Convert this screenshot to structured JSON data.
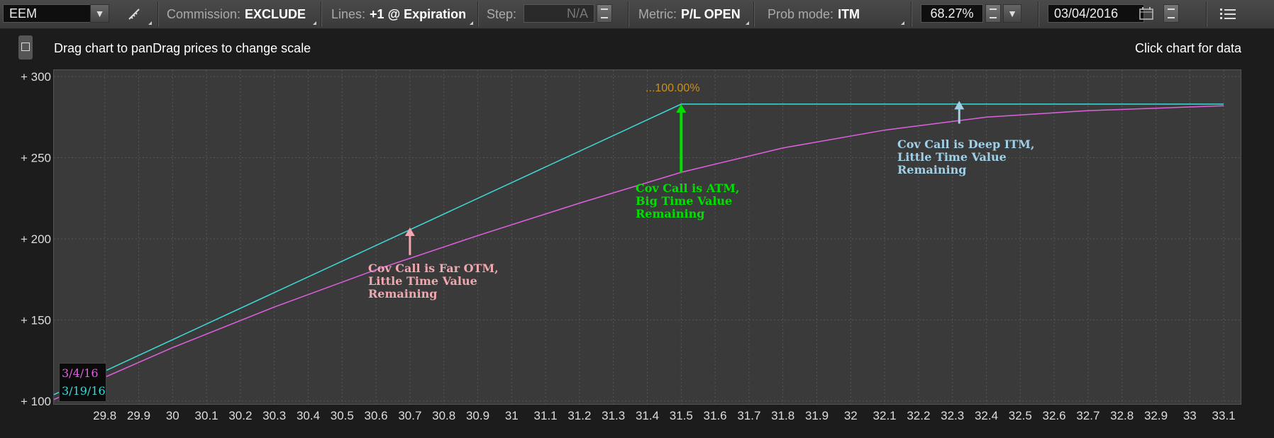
{
  "toolbar": {
    "symbol": "EEM",
    "commission_label": "Commission:",
    "commission_value": "EXCLUDE",
    "lines_label": "Lines:",
    "lines_value": "+1 @ Expiration",
    "step_label": "Step:",
    "step_value": "N/A",
    "metric_label": "Metric:",
    "metric_value": "P/L OPEN",
    "prob_label": "Prob mode:",
    "prob_value": "ITM",
    "prob_pct": "68.27%",
    "date_value": "03/04/2016"
  },
  "hints": {
    "left": "Drag chart to panDrag prices to change scale",
    "right": "Click chart for data"
  },
  "colors": {
    "cyan": "#40d8d8",
    "magenta": "#e060e0",
    "pink": "#f0a8b0",
    "green": "#00e000",
    "lightblue": "#a0d0e8",
    "orange": "#c89020"
  },
  "chart_data": {
    "type": "line",
    "xlim": [
      29.65,
      33.15
    ],
    "ylim": [
      100,
      300
    ],
    "x_ticks": [
      "29.8",
      "29.9",
      "30",
      "30.1",
      "30.2",
      "30.3",
      "30.4",
      "30.5",
      "30.6",
      "30.7",
      "30.8",
      "30.9",
      "31",
      "31.1",
      "31.2",
      "31.3",
      "31.4",
      "31.5",
      "31.6",
      "31.7",
      "31.8",
      "31.9",
      "32",
      "32.1",
      "32.2",
      "32.3",
      "32.4",
      "32.5",
      "32.6",
      "32.7",
      "32.8",
      "32.9",
      "33",
      "33.1"
    ],
    "y_ticks": [
      "+ 300",
      "+ 250",
      "+ 200",
      "+ 150",
      "+ 100"
    ],
    "y_tick_values": [
      300,
      250,
      200,
      150,
      100
    ],
    "series": [
      {
        "name": "3/19/16",
        "color": "#40d8d8",
        "x": [
          29.65,
          31.5,
          33.1
        ],
        "y": [
          104,
          283,
          283
        ]
      },
      {
        "name": "3/4/16",
        "color": "#e060e0",
        "x": [
          29.65,
          30.0,
          30.3,
          30.6,
          30.9,
          31.2,
          31.5,
          31.8,
          32.1,
          32.4,
          32.7,
          33.1
        ],
        "y": [
          101,
          133,
          158,
          181,
          202,
          222,
          241,
          256,
          267,
          275,
          279,
          282
        ]
      }
    ],
    "probability_label": "...100.00%",
    "annotations": [
      {
        "text": "Cov Call is Far OTM,\nLittle Time Value\nRemaining",
        "x": 30.7,
        "y_from": 190,
        "y_to": 207,
        "color": "#f0a8b0"
      },
      {
        "text": "Cov Call is ATM,\nBig Time Value\nRemaining",
        "x": 31.5,
        "y_from": 241,
        "y_to": 283,
        "color": "#00e000"
      },
      {
        "text": "Cov Call is Deep ITM,\nLittle Time Value\nRemaining",
        "x": 32.32,
        "y_from": 271,
        "y_to": 285,
        "color": "#a0d0e8"
      }
    ]
  }
}
